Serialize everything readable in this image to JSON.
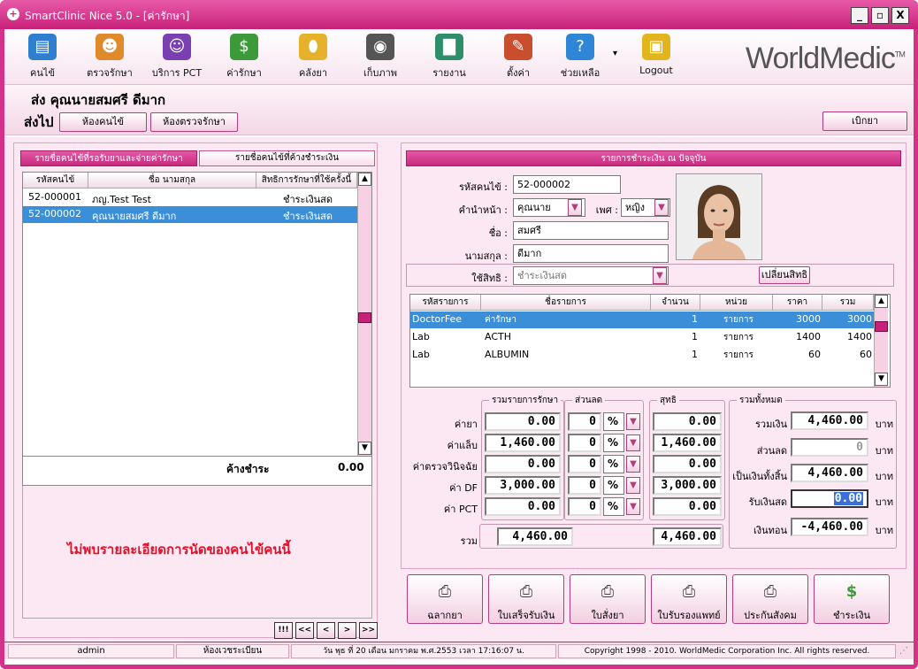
{
  "window": {
    "title": "SmartClinic Nice 5.0 - [ค่ารักษา]",
    "min": "_",
    "max": "▫",
    "close": "X"
  },
  "toolbar": {
    "items": [
      {
        "label": "คนไข้",
        "icon": "patient-folder-icon",
        "color": "#2f7fd0",
        "glyph": "▤"
      },
      {
        "label": "ตรวจรักษา",
        "icon": "doctor-icon",
        "color": "#e08a2c",
        "glyph": "☻"
      },
      {
        "label": "บริการ PCT",
        "icon": "masks-icon",
        "color": "#7a3fb0",
        "glyph": "☺"
      },
      {
        "label": "ค่ารักษา",
        "icon": "money-icon",
        "color": "#3d9a3b",
        "glyph": "$"
      },
      {
        "label": "คลังยา",
        "icon": "capsule-icon",
        "color": "#e6b22c",
        "glyph": "⬮"
      },
      {
        "label": "เก็บภาพ",
        "icon": "camera-icon",
        "color": "#555555",
        "glyph": "◉"
      },
      {
        "label": "รายงาน",
        "icon": "bar-chart-icon",
        "color": "#2d8f6a",
        "glyph": "▇"
      },
      {
        "label": "ตั้งค่า",
        "icon": "tools-icon",
        "color": "#c94e2e",
        "glyph": "✎"
      },
      {
        "label": "ช่วยเหลือ",
        "icon": "help-icon",
        "color": "#2f86d6",
        "glyph": "?"
      },
      {
        "label": "Logout",
        "icon": "lock-icon",
        "color": "#e2b51f",
        "glyph": "▣"
      }
    ],
    "dropdown_marker": "▾"
  },
  "brand": {
    "name": "WorldMedic",
    "tm": "TM"
  },
  "header": {
    "patient_name": "ส่ง  คุณนายสมศรี ดีมาก",
    "sendto_label": "ส่งไป",
    "btn_exam_room": "ห้องคนไข้",
    "btn_treatment_room": "ห้องตรวจรักษา",
    "btn_dispense": "เบิกยา"
  },
  "left": {
    "tab_waiting": "รายชื่อคนไข้ที่รอรับยาและจ่ายค่ารักษา",
    "tab_outstanding": "รายชื่อคนไข้ที่ค้างชำระเงิน",
    "cols": [
      "รหัสคนไข้",
      "ชื่อ นามสกุล",
      "สิทธิการรักษาที่ใช้ครั้งนี้"
    ],
    "rows": [
      {
        "id": "52-000001",
        "name": "ภญ.Test Test",
        "right": "ชำระเงินสด"
      },
      {
        "id": "52-000002",
        "name": "คุณนายสมศรี ดีมาก",
        "right": "ชำระเงินสด"
      }
    ],
    "outstanding_label": "ค้างชำระ",
    "outstanding_value": "0.00",
    "no_appointment": "ไม่พบรายละเอียดการนัดของคนไข้คนนี้",
    "nav": [
      "!!!",
      "<<",
      "<",
      ">",
      ">>"
    ]
  },
  "right": {
    "title": "รายการชำระเงิน ณ ปัจจุบัน",
    "labels": {
      "id": "รหัสคนไข้ :",
      "prefix": "คำนำหน้า :",
      "sex": "เพศ :",
      "fname": "ชื่อ :",
      "lname": "นามสกุล :",
      "rights": "ใช้สิทธิ :"
    },
    "values": {
      "id": "52-000002",
      "prefix": "คุณนาย",
      "sex": "หญิง",
      "fname": "สมศรี",
      "lname": "ดีมาก",
      "rights": "ชำระเงินสด"
    },
    "btn_change_rights": "เปลี่ยนสิทธิ",
    "item_cols": [
      "รหัสรายการ",
      "ชื่อรายการ",
      "จำนวน",
      "หน่วย",
      "ราคา",
      "รวม"
    ],
    "items": [
      {
        "code": "DoctorFee",
        "name": "ค่ารักษา",
        "qty": "1",
        "unit": "รายการ",
        "price": "3000",
        "total": "3000"
      },
      {
        "code": "Lab",
        "name": "ACTH",
        "qty": "1",
        "unit": "รายการ",
        "price": "1400",
        "total": "1400"
      },
      {
        "code": "Lab",
        "name": "ALBUMIN",
        "qty": "1",
        "unit": "รายการ",
        "price": "60",
        "total": "60"
      }
    ],
    "grp_sum": "รวมรายการรักษา",
    "grp_disc": "ส่วนลด",
    "grp_net": "สุทธิ",
    "grp_total": "รวมทั้งหมด",
    "cost_rows": [
      {
        "label": "ค่ายา",
        "sum": "0.00",
        "disc": "0",
        "unit": "%",
        "net": "0.00"
      },
      {
        "label": "ค่าแล็บ",
        "sum": "1,460.00",
        "disc": "0",
        "unit": "%",
        "net": "1,460.00"
      },
      {
        "label": "ค่าตรวจวินิจฉัย",
        "sum": "0.00",
        "disc": "0",
        "unit": "%",
        "net": "0.00"
      },
      {
        "label": "ค่า DF",
        "sum": "3,000.00",
        "disc": "0",
        "unit": "%",
        "net": "3,000.00"
      },
      {
        "label": "ค่า PCT",
        "sum": "0.00",
        "disc": "0",
        "unit": "%",
        "net": "0.00"
      }
    ],
    "sum_label": "รวม",
    "sum_total": "4,460.00",
    "net_total": "4,460.00",
    "totals": [
      {
        "label": "รวมเงิน",
        "value": "4,460.00",
        "unit": "บาท"
      },
      {
        "label": "ส่วนลด",
        "value": "0",
        "unit": "บาท"
      },
      {
        "label": "เป็นเงินทั้งสิ้น",
        "value": "4,460.00",
        "unit": "บาท"
      },
      {
        "label": "รับเงินสด",
        "value": "0.00",
        "unit": "บาท"
      },
      {
        "label": "เงินทอน",
        "value": "-4,460.00",
        "unit": "บาท"
      }
    ],
    "actions": [
      {
        "label": "ฉลากยา",
        "icon": "printer-icon"
      },
      {
        "label": "ใบเสร็จรับเงิน",
        "icon": "printer-receipt-icon"
      },
      {
        "label": "ใบสั่งยา",
        "icon": "printer-prescription-icon"
      },
      {
        "label": "ใบรับรองแพทย์",
        "icon": "printer-certificate-icon"
      },
      {
        "label": "ประกันสังคม",
        "icon": "printer-social-security-icon"
      },
      {
        "label": "ชำระเงิน",
        "icon": "money-icon"
      }
    ]
  },
  "status": {
    "user": "admin",
    "room": "ห้องเวชระเบียน",
    "datetime": "วัน พุธ ที่ 20 เดือน มกราคม พ.ศ.2553 เวลา 17:16:07 น.",
    "copyright": "Copyright 1998 - 2010. WorldMedic Corporation Inc. All rights reserved."
  }
}
